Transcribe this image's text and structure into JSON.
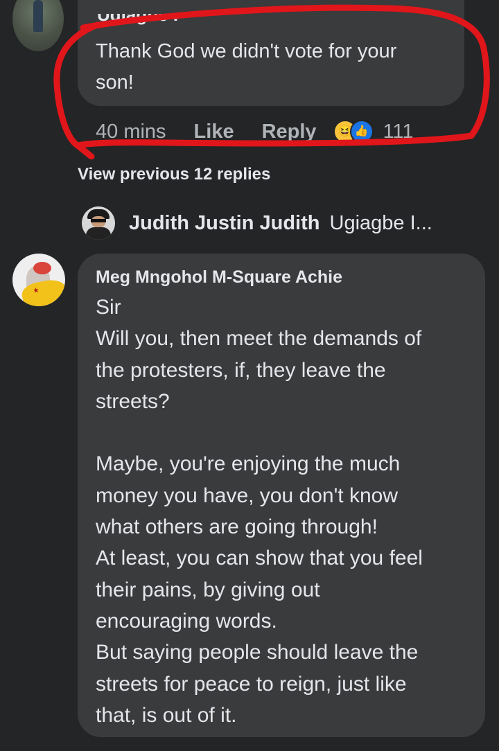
{
  "top_comment": {
    "author": "Ugiagbe I",
    "text": "Thank God we didn't vote for your son!",
    "time": "40 mins",
    "like_label": "Like",
    "reply_label": "Reply",
    "reaction_icons": [
      "haha-icon",
      "like-icon"
    ],
    "reaction_count": "111"
  },
  "highlight_color": "#e1161b",
  "view_previous": "View previous 12 replies",
  "collapsed_reply": {
    "author": "Judith Justin Judith",
    "snippet": "Ugiagbe I..."
  },
  "main_comment": {
    "author": "Meg Mngohol M-Square Achie",
    "lines": [
      "Sir",
      "Will you, then meet the demands of",
      "the protesters, if, they leave the",
      "streets?",
      "",
      "Maybe, you're enjoying the much",
      "money you have, you don't know",
      "what others are going through!",
      "At least, you can show that you feel",
      "their pains, by giving out",
      "encouraging words.",
      "But saying people should leave the",
      "streets for peace to reign, just like",
      "that, is out of it."
    ]
  }
}
